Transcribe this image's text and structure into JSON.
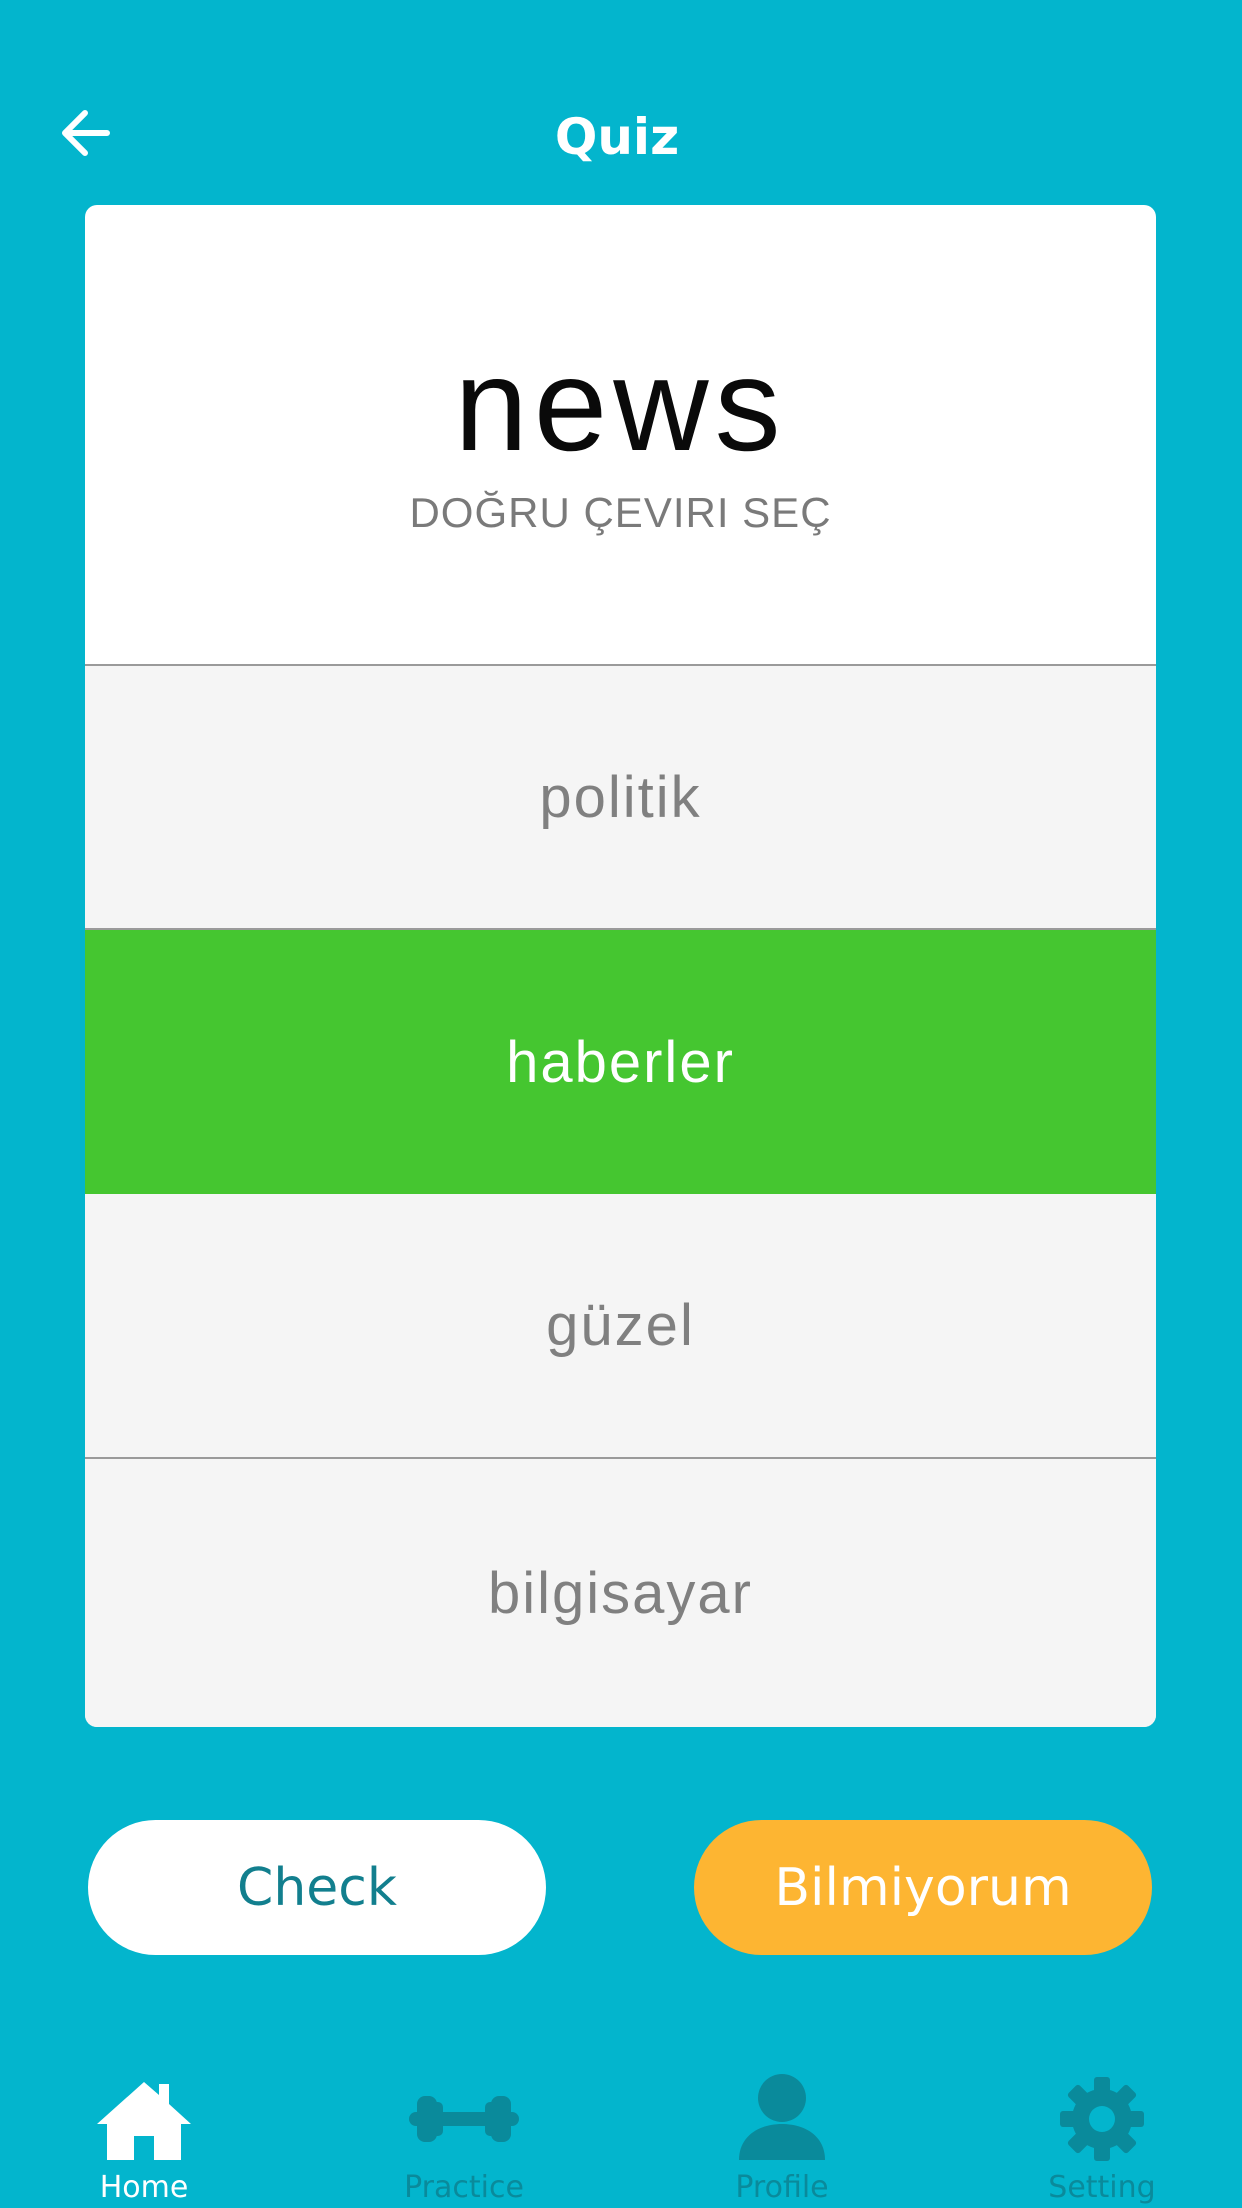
{
  "header": {
    "title": "Quiz",
    "back_icon": "arrow-left-icon"
  },
  "question": {
    "word": "news",
    "instruction": "DOĞRU ÇEVIRI SEÇ"
  },
  "options": [
    {
      "label": "politik",
      "selected": false
    },
    {
      "label": "haberler",
      "selected": true
    },
    {
      "label": "güzel",
      "selected": false
    },
    {
      "label": "bilgisayar",
      "selected": false
    }
  ],
  "actions": {
    "check_label": "Check",
    "dont_know_label": "Bilmiyorum"
  },
  "nav": {
    "items": [
      {
        "label": "Home",
        "icon": "home-icon",
        "active": true
      },
      {
        "label": "Practice",
        "icon": "dumbbell-icon",
        "active": false
      },
      {
        "label": "Profile",
        "icon": "person-icon",
        "active": false
      },
      {
        "label": "Setting",
        "icon": "gear-icon",
        "active": false
      }
    ]
  },
  "colors": {
    "background": "#03B5CD",
    "selected_option": "#45C630",
    "option_bg": "#F5F5F5",
    "check_text": "#127F8E",
    "dont_know_button": "#FDB532",
    "nav_active": "#FFFFFF",
    "nav_inactive": "#0A8A9B"
  }
}
